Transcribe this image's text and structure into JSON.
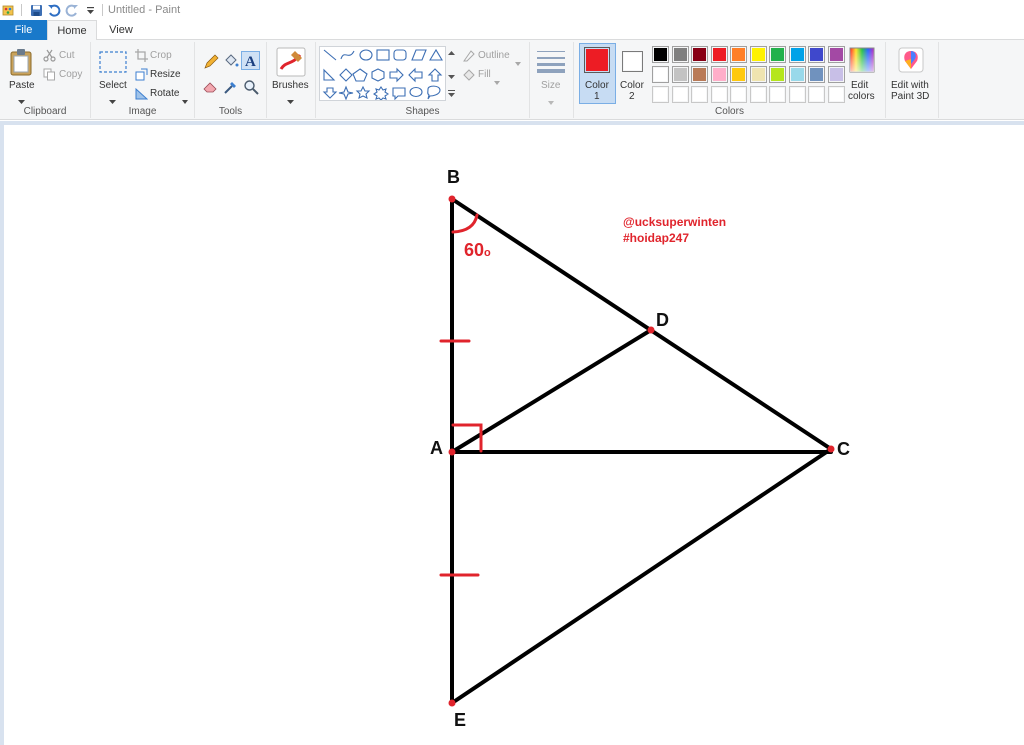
{
  "window": {
    "title": "Untitled - Paint"
  },
  "tabs": {
    "file": "File",
    "home": "Home",
    "view": "View"
  },
  "clipboard": {
    "paste": "Paste",
    "cut": "Cut",
    "copy": "Copy",
    "group": "Clipboard"
  },
  "image": {
    "select": "Select",
    "crop": "Crop",
    "resize": "Resize",
    "rotate": "Rotate",
    "group": "Image"
  },
  "tools": {
    "group": "Tools"
  },
  "brushes": {
    "label": "Brushes"
  },
  "shapes": {
    "outline": "Outline",
    "fill": "Fill",
    "group": "Shapes"
  },
  "size": {
    "label": "Size"
  },
  "colors": {
    "color1": "Color",
    "color1_num": "1",
    "color2": "Color",
    "color2_num": "2",
    "edit_colors_1": "Edit",
    "edit_colors_2": "colors",
    "group": "Colors",
    "color1_value": "#ed1c24",
    "color2_value": "#ffffff",
    "palette_row1": [
      "#000000",
      "#7f7f7f",
      "#880015",
      "#ed1c24",
      "#ff7f27",
      "#fff200",
      "#22b14c",
      "#00a2e8",
      "#3f48cc",
      "#a349a4"
    ],
    "palette_row2": [
      "#ffffff",
      "#c3c3c3",
      "#b97a57",
      "#ffaec9",
      "#ffc90e",
      "#efe4b0",
      "#b5e61d",
      "#99d9ea",
      "#7092be",
      "#c8bfe7"
    ]
  },
  "paint3d": {
    "label1": "Edit with",
    "label2": "Paint 3D"
  },
  "drawing": {
    "vertices": {
      "B": "B",
      "D": "D",
      "A": "A",
      "C": "C",
      "E": "E"
    },
    "angle_label": "60",
    "angle_unit": "o",
    "watermark_line1": "@ucksuperwinten",
    "watermark_line2": "#hoidap247",
    "ink_color": "#e0242c"
  }
}
